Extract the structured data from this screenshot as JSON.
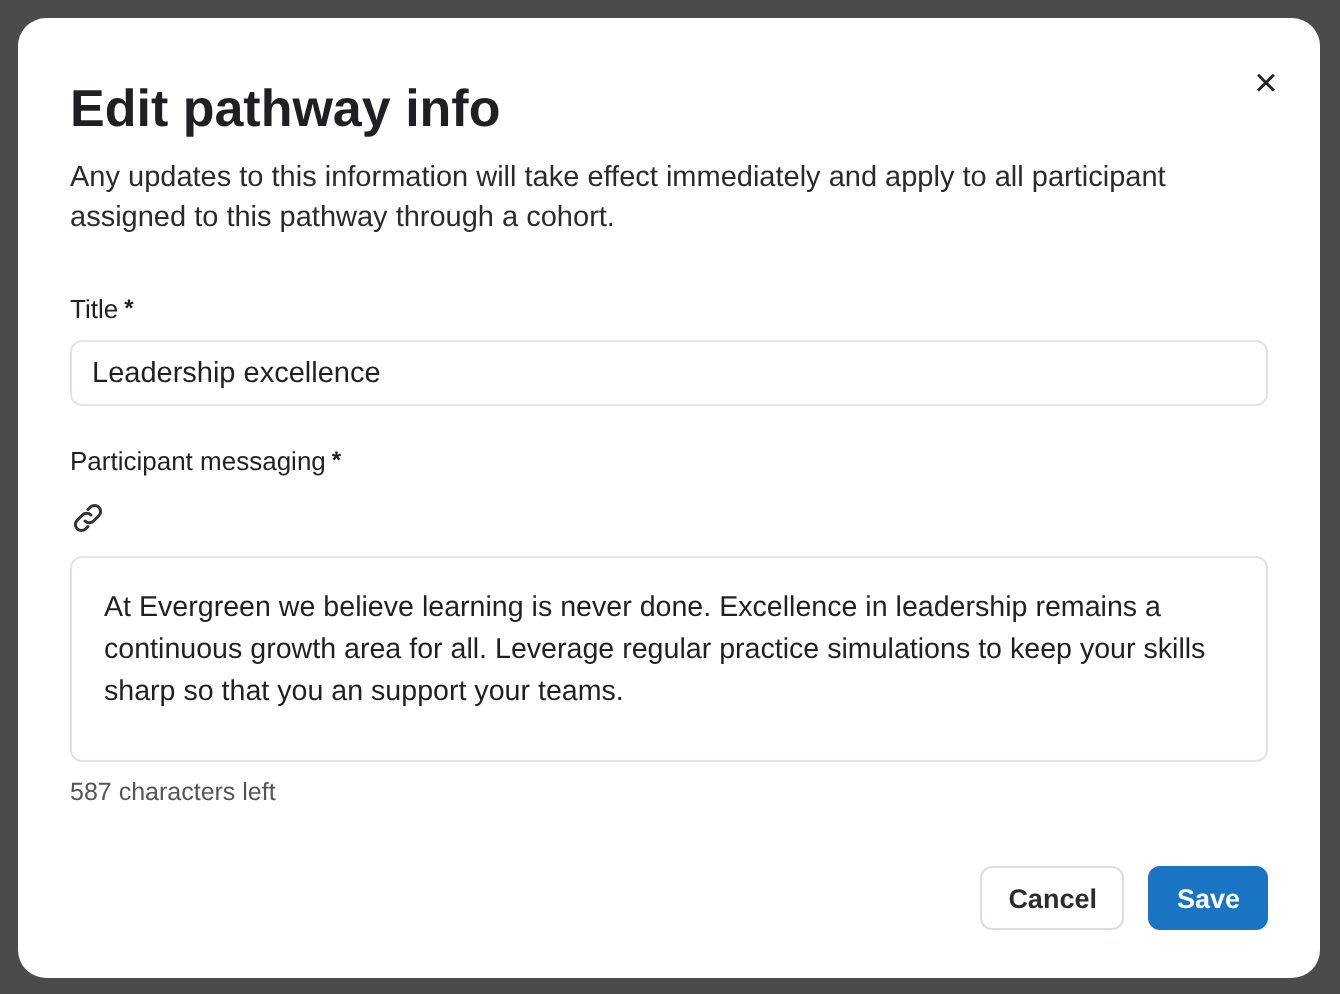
{
  "dialog": {
    "title": "Edit pathway info",
    "close": "×",
    "description": "Any updates to this information will take effect immediately and apply to all participant assigned to this pathway through a cohort."
  },
  "fields": [
    {
      "kind": "input",
      "label": "Title",
      "required_mark": "*",
      "value": "Leadership excellence"
    },
    {
      "kind": "textarea",
      "label": "Participant messaging",
      "required_mark": "*",
      "value": "At Evergreen we believe learning is never done. Excellence in leadership remains a continuous growth area for all. Leverage regular practice simulations to keep your skills sharp so that you an support your teams.",
      "hint": "587 characters left"
    }
  ],
  "buttons": [
    {
      "label": "Cancel",
      "kind": "secondary"
    },
    {
      "label": "Save",
      "kind": "primary"
    }
  ]
}
